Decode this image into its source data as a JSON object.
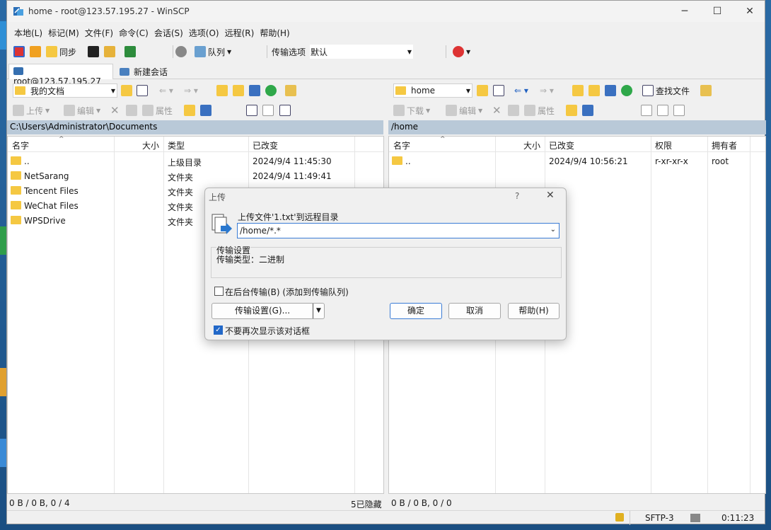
{
  "window": {
    "title": "home - root@123.57.195.27 - WinSCP"
  },
  "menu": [
    "本地(L)",
    "标记(M)",
    "文件(F)",
    "命令(C)",
    "会话(S)",
    "选项(O)",
    "远程(R)",
    "帮助(H)"
  ],
  "toolbar": {
    "sync": "同步",
    "queue": "队列",
    "transfer_label": "传输选项",
    "transfer_value": "默认"
  },
  "tabs": {
    "session": "root@123.57.195.27",
    "new_session": "新建会话"
  },
  "local": {
    "location": "我的文档",
    "upload": "上传",
    "edit": "编辑",
    "properties": "属性",
    "path": "C:\\Users\\Administrator\\Documents",
    "columns": [
      "名字",
      "大小",
      "类型",
      "已改变"
    ],
    "rows": [
      {
        "name": "..",
        "type": "上级目录",
        "changed": "2024/9/4  11:45:30"
      },
      {
        "name": "NetSarang",
        "type": "文件夹",
        "changed": "2024/9/4  11:49:41"
      },
      {
        "name": "Tencent Files",
        "type": "文件夹",
        "changed": ""
      },
      {
        "name": "WeChat Files",
        "type": "文件夹",
        "changed": ""
      },
      {
        "name": "WPSDrive",
        "type": "文件夹",
        "changed": ""
      }
    ],
    "status_left": "0 B / 0 B,  0 / 4",
    "status_hidden": "5已隐藏"
  },
  "remote": {
    "location": "home",
    "find": "查找文件",
    "download": "下载",
    "edit": "编辑",
    "properties": "属性",
    "path": "/home",
    "columns": [
      "名字",
      "大小",
      "已改变",
      "权限",
      "拥有者"
    ],
    "rows": [
      {
        "name": "..",
        "changed": "2024/9/4 10:56:21",
        "rights": "r-xr-xr-x",
        "owner": "root"
      }
    ],
    "status_left": "0 B / 0 B,  0 / 0"
  },
  "status": {
    "protocol": "SFTP-3",
    "time": "0:11:23"
  },
  "dialog": {
    "title": "上传",
    "help_glyph": "?",
    "heading": "上传文件'1.txt'到远程目录",
    "target": "/home/*.*",
    "group_title": "传输设置",
    "group_line": "传输类型：二进制",
    "background": "在后台传输(B) (添加到传输队列)",
    "settings_btn": "传输设置(G)...",
    "ok": "确定",
    "cancel": "取消",
    "help": "帮助(H)",
    "dont_show": "不要再次显示该对话框"
  },
  "colors": {
    "accent": "#2268c8",
    "path_bar": "#b9c9d8",
    "folder": "#f5c842"
  }
}
